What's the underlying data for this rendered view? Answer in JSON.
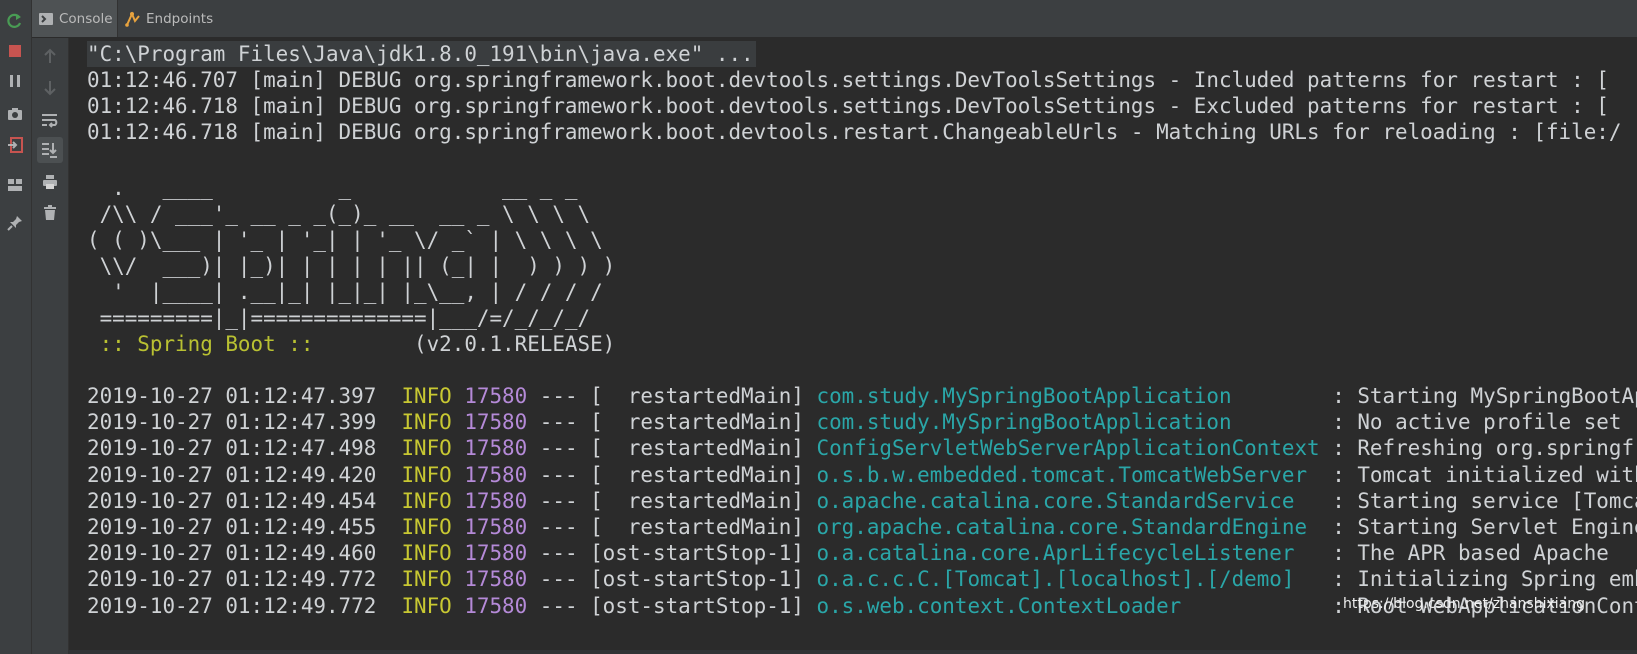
{
  "tabs": [
    {
      "label": "Console",
      "icon": "console-icon"
    },
    {
      "label": "Endpoints",
      "icon": "endpoints-icon"
    }
  ],
  "outer_toolbar": [
    "rerun-icon",
    "stop-icon",
    "pause-icon",
    "screenshot-icon",
    "exit-icon",
    "layout-icon",
    "pin-icon"
  ],
  "inner_toolbar": [
    "up-arrow-icon",
    "down-arrow-icon",
    "soft-wrap-icon",
    "scroll-to-end-icon",
    "print-icon",
    "trash-icon"
  ],
  "console": {
    "command": "\"C:\\Program Files\\Java\\jdk1.8.0_191\\bin\\java.exe\" ...",
    "debug_lines": [
      "01:12:46.707 [main] DEBUG org.springframework.boot.devtools.settings.DevToolsSettings - Included patterns for restart : [",
      "01:12:46.718 [main] DEBUG org.springframework.boot.devtools.settings.DevToolsSettings - Excluded patterns for restart : [",
      "01:12:46.718 [main] DEBUG org.springframework.boot.devtools.restart.ChangeableUrls - Matching URLs for reloading : [file:/"
    ],
    "banner": [
      "  .   ____          _            __ _ _",
      " /\\\\ / ___'_ __ _ _(_)_ __  __ _ \\ \\ \\ \\",
      "( ( )\\___ | '_ | '_| | '_ \\/ _` | \\ \\ \\ \\",
      " \\\\/  ___)| |_)| | | | | || (_| |  ) ) ) )",
      "  '  |____| .__|_| |_|_| |_\\__, | / / / /",
      " =========|_|==============|___/=/_/_/_/"
    ],
    "spring_boot_label": " :: Spring Boot :: ",
    "spring_boot_version": "       (v2.0.1.RELEASE)",
    "log_entries": [
      {
        "timestamp": "2019-10-27 01:12:47.397",
        "level": "INFO",
        "pid": "17580",
        "sep": "---",
        "thread": "[  restartedMain]",
        "logger": "com.study.MySpringBootApplication        ",
        "message": ": Starting MySpringBootApplication"
      },
      {
        "timestamp": "2019-10-27 01:12:47.399",
        "level": "INFO",
        "pid": "17580",
        "sep": "---",
        "thread": "[  restartedMain]",
        "logger": "com.study.MySpringBootApplication        ",
        "message": ": No active profile set"
      },
      {
        "timestamp": "2019-10-27 01:12:47.498",
        "level": "INFO",
        "pid": "17580",
        "sep": "---",
        "thread": "[  restartedMain]",
        "logger": "ConfigServletWebServerApplicationContext ",
        "message": ": Refreshing org.springframework"
      },
      {
        "timestamp": "2019-10-27 01:12:49.420",
        "level": "INFO",
        "pid": "17580",
        "sep": "---",
        "thread": "[  restartedMain]",
        "logger": "o.s.b.w.embedded.tomcat.TomcatWebServer  ",
        "message": ": Tomcat initialized with"
      },
      {
        "timestamp": "2019-10-27 01:12:49.454",
        "level": "INFO",
        "pid": "17580",
        "sep": "---",
        "thread": "[  restartedMain]",
        "logger": "o.apache.catalina.core.StandardService   ",
        "message": ": Starting service [Tomcat]"
      },
      {
        "timestamp": "2019-10-27 01:12:49.455",
        "level": "INFO",
        "pid": "17580",
        "sep": "---",
        "thread": "[  restartedMain]",
        "logger": "org.apache.catalina.core.StandardEngine  ",
        "message": ": Starting Servlet Engine"
      },
      {
        "timestamp": "2019-10-27 01:12:49.460",
        "level": "INFO",
        "pid": "17580",
        "sep": "---",
        "thread": "[ost-startStop-1]",
        "logger": "o.a.catalina.core.AprLifecycleListener   ",
        "message": ": The APR based Apache"
      },
      {
        "timestamp": "2019-10-27 01:12:49.772",
        "level": "INFO",
        "pid": "17580",
        "sep": "---",
        "thread": "[ost-startStop-1]",
        "logger": "o.a.c.c.C.[Tomcat].[localhost].[/demo]   ",
        "message": ": Initializing Spring embedded"
      },
      {
        "timestamp": "2019-10-27 01:12:49.772",
        "level": "INFO",
        "pid": "17580",
        "sep": "---",
        "thread": "[ost-startStop-1]",
        "logger": "o.s.web.context.ContextLoader            ",
        "message": ": Root WebApplicationContext"
      }
    ]
  },
  "watermark": "https://blog.csdn.net/zhanshixiang",
  "colors": {
    "background": "#2b2b2b",
    "panel": "#3c3f41",
    "text": "#cfd2d5",
    "info": "#c8c832",
    "pid": "#b58ad8",
    "logger": "#2aa6a8",
    "spring_label": "#b9c132",
    "run_green": "#499c54",
    "stop_red": "#c75450",
    "endpoints_orange": "#e8a33e"
  }
}
